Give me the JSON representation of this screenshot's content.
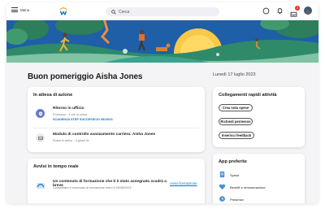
{
  "header": {
    "menu_label": "Menu",
    "search_placeholder": "Cerca",
    "notification_count": "2",
    "colors": {
      "accent": "#0b73c8",
      "badge": "#e3352a"
    }
  },
  "greeting": "Buon pomeriggio Aisha Jones",
  "date": "Lunedì 17 luglio 2023",
  "actions_card": {
    "title": "In attesa di azione",
    "items": [
      {
        "title": "Ritorno in ufficio",
        "subtitle": "Processo · 4 ore in corso",
        "link": "SCADENZA STEP SUCCESSIVO 05/15/23",
        "icon": "location-pin-icon"
      },
      {
        "title": "Modulo di controllo avanzamento carriera: Aisha Jones",
        "subtitle": "Posta in arrivo · 4 giorni fa",
        "icon": "inbox-icon"
      }
    ]
  },
  "announcements_card": {
    "title": "Avvisi in tempo reale",
    "items": [
      {
        "title": "Un contenuto di formazione che ti è stato assegnato scadrà a breve",
        "subtitle": "Completare il contenuto di formazione entro il 09/08/2023",
        "action": "Avvia formazione",
        "icon": "learning-icon"
      }
    ]
  },
  "quick_links": {
    "title": "Collegamenti rapidi attività",
    "buttons": [
      "Crea nota spese",
      "Richiedi permesso",
      "Inserisci feedback"
    ]
  },
  "apps": {
    "title": "App preferite",
    "items": [
      {
        "label": "Spese",
        "icon": "expenses-icon"
      },
      {
        "label": "Benefit e remunerazione",
        "icon": "benefits-icon"
      },
      {
        "label": "Presenze",
        "icon": "time-icon"
      }
    ]
  }
}
